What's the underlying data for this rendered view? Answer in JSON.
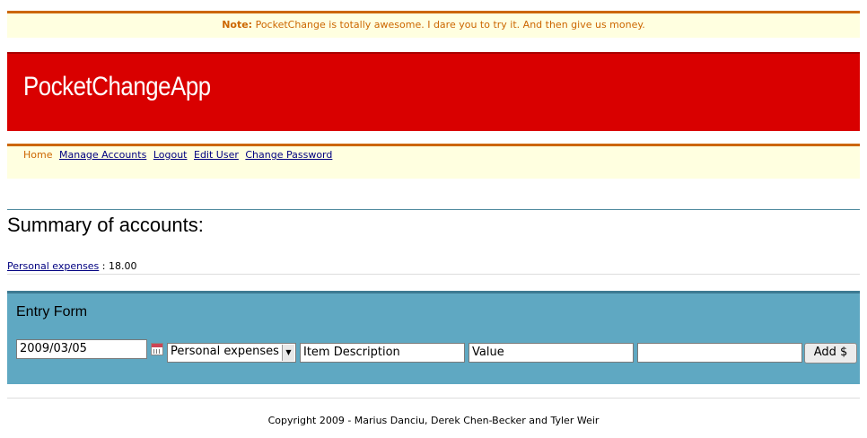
{
  "note": {
    "label": "Note:",
    "text": "PocketChange is totally awesome. I dare you to try it. And then give us money."
  },
  "brand": {
    "title": "PocketChangeApp"
  },
  "nav": {
    "items": [
      "Home",
      "Manage Accounts",
      "Logout",
      "Edit User",
      "Change Password"
    ]
  },
  "summary": {
    "title": "Summary of accounts:",
    "accounts": [
      {
        "name": "Personal expenses",
        "separator": " : ",
        "balance": "18.00"
      }
    ]
  },
  "entry_form": {
    "title": "Entry Form",
    "date_value": "2009/03/05",
    "account_selected": "Personal expenses",
    "description_value": "Item Description",
    "value_value": "Value",
    "tags_value": "",
    "add_label": "Add $"
  },
  "footer": {
    "copyright": "Copyright 2009 - Marius Danciu, Derek Chen-Becker and Tyler Weir"
  },
  "colors": {
    "note_bg": "#ffffe0",
    "accent_orange": "#cc6600",
    "banner_red": "#d90000",
    "form_blue": "#5fa8c2",
    "link_navy": "#000080"
  }
}
